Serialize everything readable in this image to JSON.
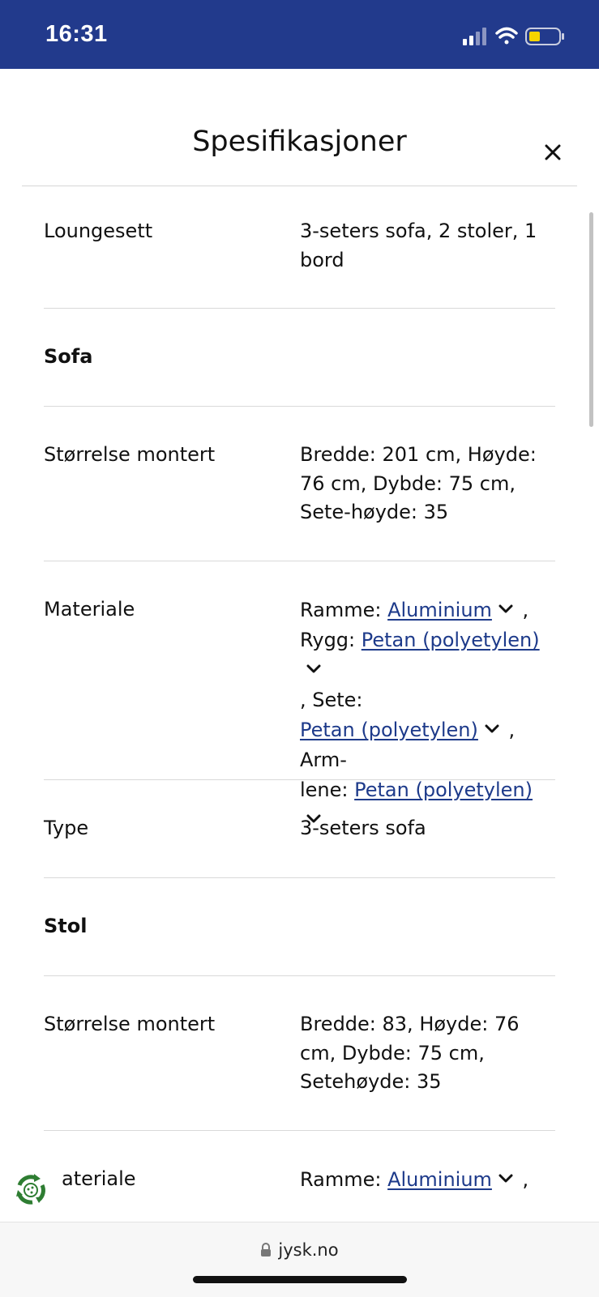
{
  "status_bar": {
    "time": "16:31",
    "battery_color": "#f5d400"
  },
  "modal": {
    "title": "Spesifikasjoner",
    "close_icon": "close-icon"
  },
  "specs": [
    {
      "label": "Loungesett",
      "value": "3-seters sofa, 2 stoler, 1 bord"
    },
    {
      "section": "Sofa"
    },
    {
      "label": "Størrelse montert",
      "value": "Bredde: 201 cm, Høyde: 76 cm, Dybde: 75 cm, Sete-høyde: 35"
    },
    {
      "label": "Materiale",
      "materials": [
        {
          "prefix": "Ramme: ",
          "link": "Aluminium",
          "suffix": " ,"
        },
        {
          "prefix": "Rygg: ",
          "link": "Petan (polyetylen)",
          "suffix": ""
        },
        {
          "prefix": ", Sete: ",
          "link": "Petan (polyetylen)",
          "suffix": " , Arm-"
        },
        {
          "prefix": "lene: ",
          "link": "Petan (polyetylen)",
          "suffix": ""
        }
      ]
    },
    {
      "label": "Type",
      "value": "3-seters sofa"
    },
    {
      "section": "Stol"
    },
    {
      "label": "Størrelse montert",
      "value": "Bredde: 83, Høyde: 76 cm, Dybde: 75 cm, Setehøyde: 35"
    },
    {
      "label": "ateriale",
      "materials": [
        {
          "prefix": "Ramme: ",
          "link": "Aluminium",
          "suffix": " ,"
        }
      ]
    }
  ],
  "bottom_bar": {
    "url": "jysk.no"
  },
  "colors": {
    "brand": "#223a8c",
    "link": "#1d3a8a",
    "eco_green": "#2e7d32"
  }
}
